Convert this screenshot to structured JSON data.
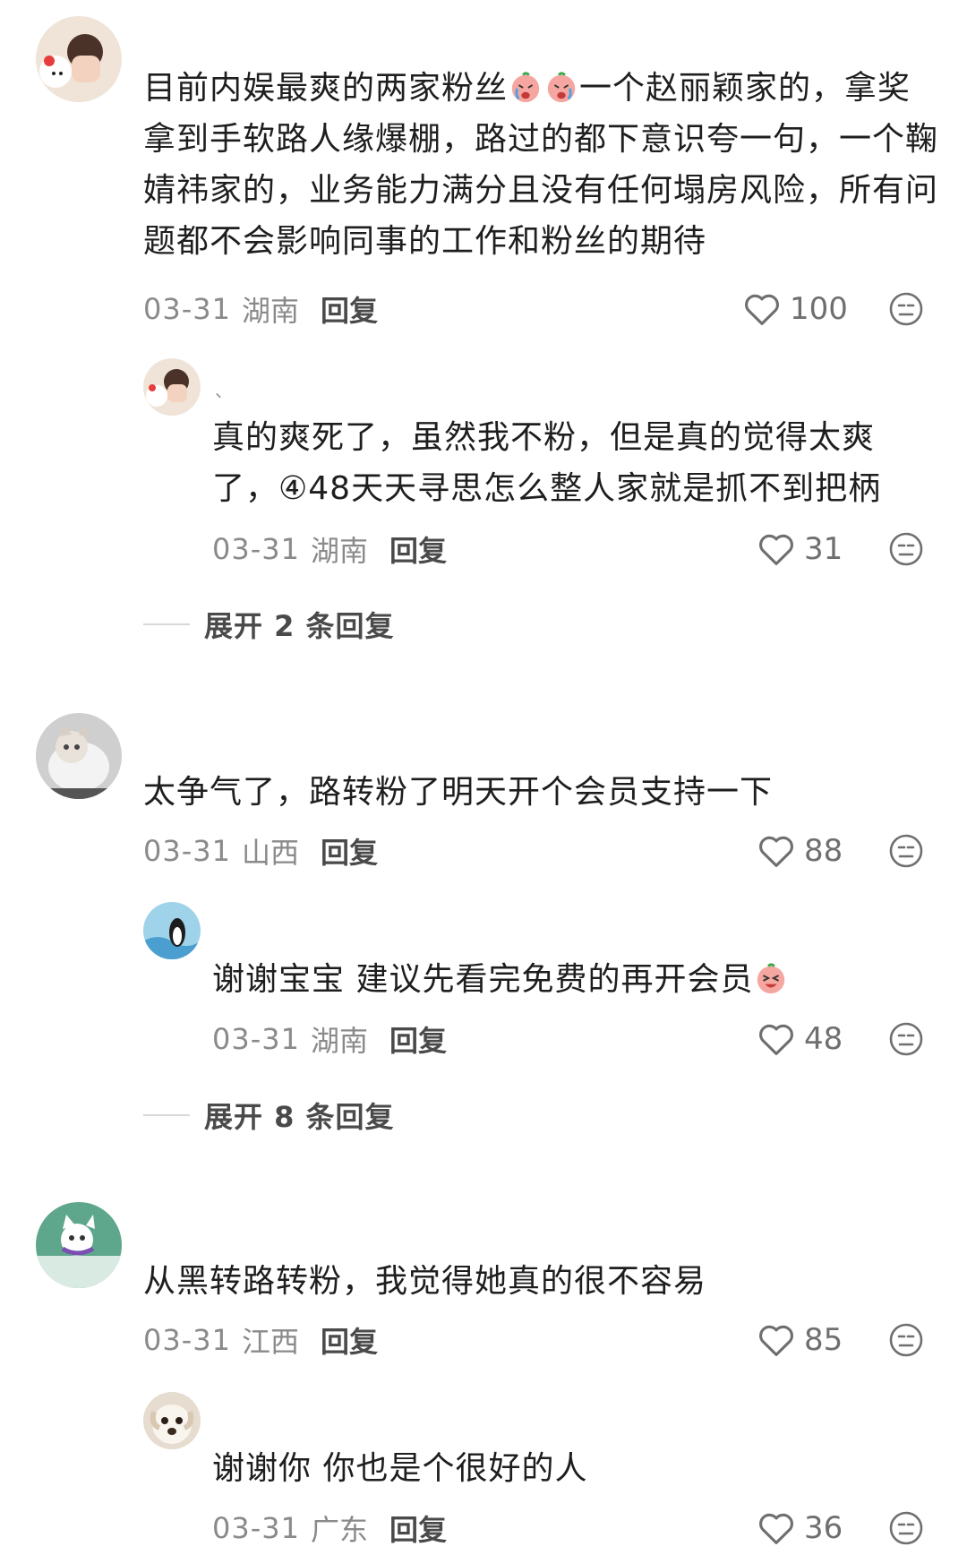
{
  "comments": [
    {
      "text_a": "目前内娱最爽的两家粉丝",
      "text_b": "一个赵丽颖家的，拿奖拿到手软路人缘爆棚，路过的都下意识夸一句，一个鞠婧祎家的，业务能力满分且没有任何塌房风险，所有问题都不会影响同事的工作和粉丝的期待",
      "date": "03-31",
      "location": "湖南",
      "reply_label": "回复",
      "likes": "100",
      "reply": {
        "name": "、",
        "text": "真的爽死了，虽然我不粉，但是真的觉得太爽了，④48天天寻思怎么整人家就是抓不到把柄",
        "date": "03-31",
        "location": "湖南",
        "reply_label": "回复",
        "likes": "31"
      },
      "expand_label": "展开 2 条回复"
    },
    {
      "text": "太争气了，路转粉了明天开个会员支持一下",
      "date": "03-31",
      "location": "山西",
      "reply_label": "回复",
      "likes": "88",
      "reply": {
        "text": "谢谢宝宝 建议先看完免费的再开会员",
        "date": "03-31",
        "location": "湖南",
        "reply_label": "回复",
        "likes": "48"
      },
      "expand_label": "展开 8 条回复"
    },
    {
      "text": "从黑转路转粉，我觉得她真的很不容易",
      "date": "03-31",
      "location": "江西",
      "reply_label": "回复",
      "likes": "85",
      "reply": {
        "text": "谢谢你 你也是个很好的人",
        "date": "03-31",
        "location": "广东",
        "reply_label": "回复",
        "likes": "36"
      }
    }
  ],
  "icons": {
    "like": "heart-outline-icon",
    "dislike": "meh-face-icon",
    "emoji_cry": "crying-peach-emoji",
    "emoji_laugh": "laughing-peach-emoji"
  },
  "colors": {
    "text": "#1e1e1e",
    "meta": "#8a8a8a",
    "action": "#4a4a4a",
    "icon": "#6f6f6f",
    "divider": "#d8d8d8"
  }
}
